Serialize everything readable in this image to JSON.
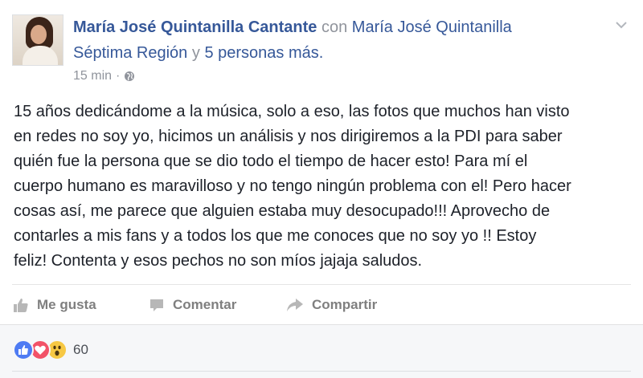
{
  "post": {
    "author": "María José Quintanilla Cantante",
    "with_text": "con",
    "tagged_line1": "María José Quintanilla",
    "tagged_line2": "Séptima Región",
    "and_text": "y",
    "others": "5 personas más.",
    "time": "15 min",
    "separator": "·",
    "privacy_icon": "globe-icon",
    "body_lines": [
      "15 años dedicándome a la música, solo a eso, las fotos que muchos han visto",
      "en redes no soy yo, hicimos un análisis y nos dirigiremos a la PDI para saber",
      "quién fue la persona que se dio todo el tiempo de hacer esto! Para mí el",
      "cuerpo humano es maravilloso y no tengo ningún problema con el! Pero hacer",
      "cosas así, me parece que alguien estaba muy desocupado!!! Aprovecho de",
      "contarles a mis fans y a todos los que me conoces que no soy yo !! Estoy",
      "feliz! Contenta y esos pechos no son míos jajaja saludos."
    ]
  },
  "actions": {
    "like": "Me gusta",
    "comment": "Comentar",
    "share": "Compartir"
  },
  "reactions": {
    "icons": [
      "like-reaction-icon",
      "love-reaction-icon",
      "wow-reaction-icon"
    ],
    "count": "60"
  },
  "colors": {
    "link": "#365899",
    "meta": "#90949c",
    "text": "#1d2129",
    "action": "#7f7f7f",
    "like": "#4e7bf3",
    "love": "#f25268",
    "wow": "#f7c844"
  }
}
